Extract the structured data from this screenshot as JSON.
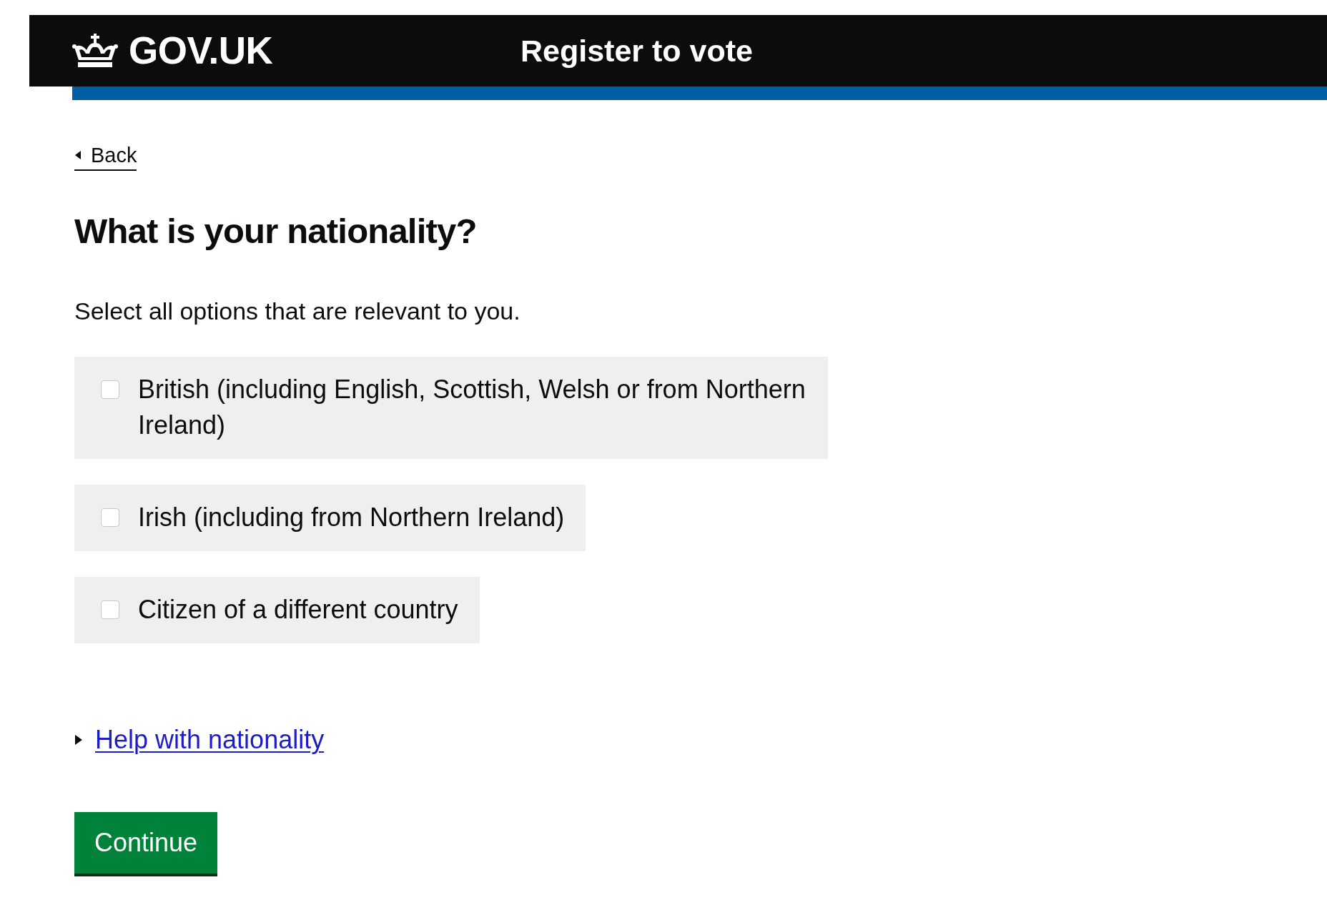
{
  "header": {
    "logo_text": "GOV.UK",
    "service_name": "Register to vote"
  },
  "back_link": "Back",
  "heading": "What is your nationality?",
  "hint": "Select all options that are relevant to you.",
  "options": [
    {
      "label": "British (including English, Scottish, Welsh or from Northern Ireland)",
      "checked": false
    },
    {
      "label": "Irish (including from Northern Ireland)",
      "checked": false
    },
    {
      "label": "Citizen of a different country",
      "checked": false
    }
  ],
  "details": {
    "summary": "Help with nationality",
    "expanded": false
  },
  "button": "Continue"
}
